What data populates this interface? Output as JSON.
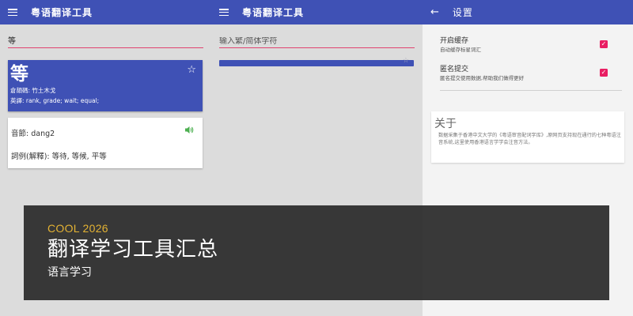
{
  "panel1": {
    "appbar_title": "粤语翻译工具",
    "search_value": "等",
    "char_card": {
      "character": "等",
      "cangjie": "倉頡碼: 竹土木戈",
      "english": "英譯: rank, grade; wait; equal;"
    },
    "detail_card": {
      "pronunciation": "音節: dang2",
      "examples": "詞例(解釋): 等待, 等候, 平等"
    }
  },
  "panel2": {
    "appbar_title": "粤语翻译工具",
    "search_placeholder": "输入繁/简体字符"
  },
  "panel3": {
    "appbar_title": "设置",
    "settings": [
      {
        "title": "开启缓存",
        "subtitle": "自动缓存标星词汇",
        "checked": true
      },
      {
        "title": "匿名提交",
        "subtitle": "匿名提交使用数据,帮助我们做得更好",
        "checked": true
      }
    ],
    "about": {
      "title": "关于",
      "text": "数据采集于香港中文大学的《粤语审音配词字库》,原网页支持现在通行的七种粤语注音系统,这里使用香港语言学学会注音方法。"
    }
  },
  "banner": {
    "tag": "COOL 2026",
    "title": "翻译学习工具汇总",
    "subtitle": "语言学习"
  },
  "colors": {
    "primary": "#3f51b5",
    "accent": "#e91e63",
    "underline": "#e0436f",
    "speaker": "#4caf50",
    "banner_tag": "#e3b233"
  }
}
